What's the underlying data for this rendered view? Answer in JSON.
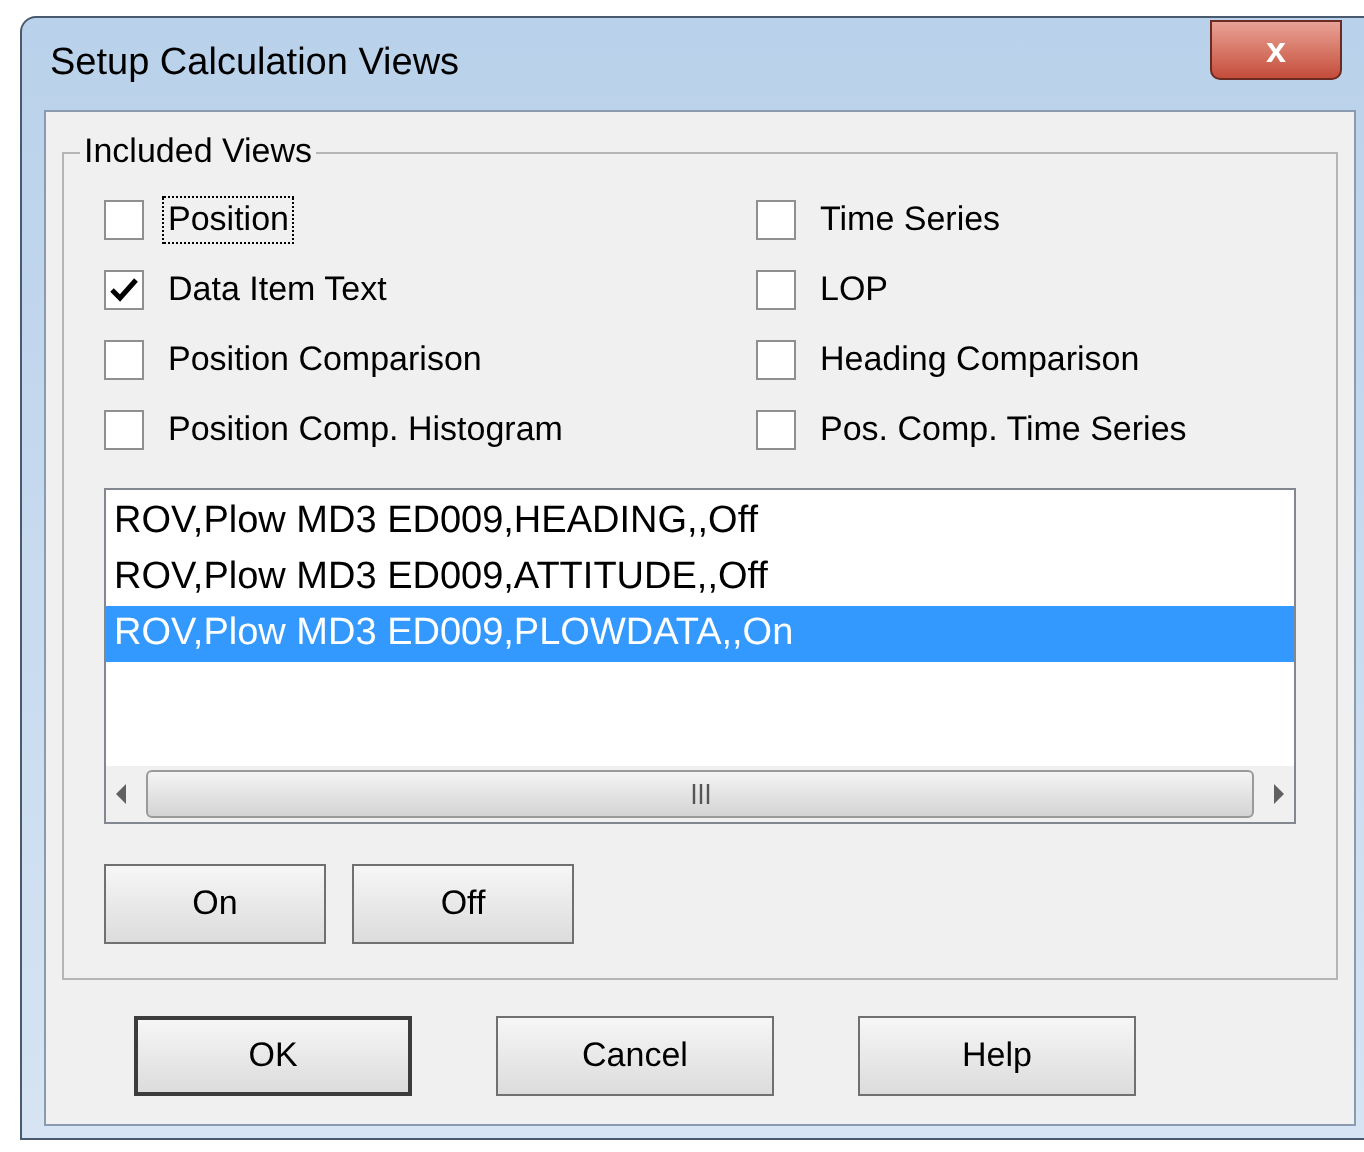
{
  "window": {
    "title": "Setup Calculation Views",
    "close_label": "x"
  },
  "included_views": {
    "legend": "Included Views",
    "checkboxes": [
      {
        "label": "Position",
        "checked": false,
        "focused": true
      },
      {
        "label": "Time Series",
        "checked": false,
        "focused": false
      },
      {
        "label": "Data Item Text",
        "checked": true,
        "focused": false
      },
      {
        "label": "LOP",
        "checked": false,
        "focused": false
      },
      {
        "label": "Position Comparison",
        "checked": false,
        "focused": false
      },
      {
        "label": "Heading Comparison",
        "checked": false,
        "focused": false
      },
      {
        "label": "Position Comp. Histogram",
        "checked": false,
        "focused": false
      },
      {
        "label": "Pos. Comp. Time Series",
        "checked": false,
        "focused": false
      }
    ],
    "list_rows": [
      {
        "text": "ROV,Plow MD3 ED009,HEADING,,Off",
        "selected": false
      },
      {
        "text": "ROV,Plow MD3 ED009,ATTITUDE,,Off",
        "selected": false
      },
      {
        "text": "ROV,Plow MD3 ED009,PLOWDATA,,On",
        "selected": true
      }
    ],
    "toggle_buttons": [
      "On",
      "Off"
    ]
  },
  "buttons": [
    {
      "label": "OK",
      "default": true
    },
    {
      "label": "Cancel",
      "default": false
    },
    {
      "label": "Help",
      "default": false
    }
  ]
}
